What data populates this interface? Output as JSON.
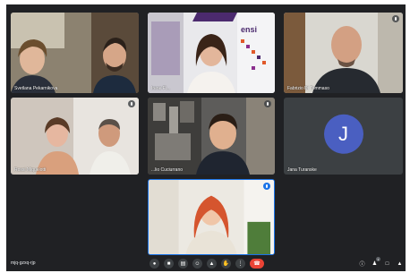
{
  "participants": [
    {
      "name": "Svetlana Pekarnikova"
    },
    {
      "name": ""
    },
    {
      "name": "Irene Fi..."
    },
    {
      "name": "Fabrizio Di Tommaso"
    },
    {
      "name": "Rossi Miquelotti"
    },
    {
      "name": "...lio Cuciurrano"
    },
    {
      "name": "Jana Turanske",
      "avatar_letter": "J"
    },
    {
      "name": ""
    }
  ],
  "banner_text": "ensi",
  "meeting_code": "mjq-gzxq-rjp",
  "notification_count": "1",
  "colors": {
    "background": "#202124",
    "avatar": "#4a5fc1",
    "end_call": "#ea4335",
    "active_speaker": "#1a73e8"
  },
  "controls": [
    "mic-icon",
    "camera-icon",
    "captions-icon",
    "emoji-icon",
    "present-icon",
    "raise-hand-icon",
    "more-icon",
    "end-call-icon"
  ],
  "right_controls": [
    "info-icon",
    "people-icon",
    "chat-icon",
    "activities-icon"
  ]
}
